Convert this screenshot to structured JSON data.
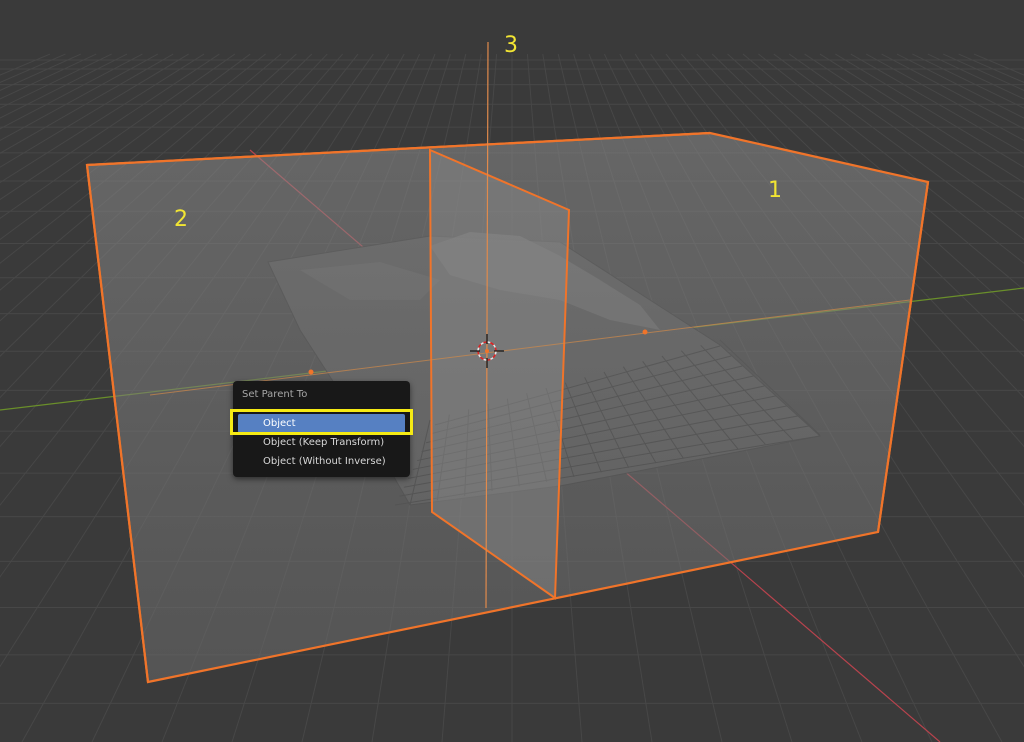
{
  "viewport": {
    "background_color": "#3a3a3a",
    "grid_color": "#444444",
    "x_axis_color": "#b8434d",
    "y_axis_color": "#6a8f2a",
    "selection_outline_color": "#f0742a",
    "annotation_color": "#f2e533"
  },
  "annotations": {
    "box_label": "1",
    "left_label": "2",
    "axis_label": "3"
  },
  "context_menu": {
    "title": "Set Parent To",
    "items": [
      {
        "label": "Object",
        "highlighted": true
      },
      {
        "label": "Object (Keep Transform)",
        "highlighted": false
      },
      {
        "label": "Object (Without Inverse)",
        "highlighted": false
      }
    ],
    "highlight_color": "#5680c2",
    "callout_color": "#f5ea14"
  }
}
